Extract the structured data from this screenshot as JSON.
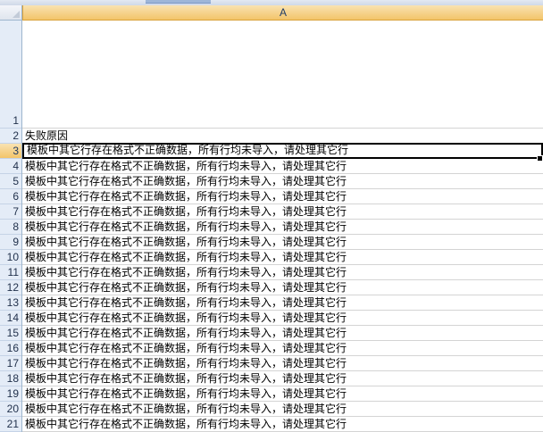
{
  "sheet": {
    "column_header": "A",
    "header_row": {
      "row_number": "2",
      "text": "失败原因"
    },
    "first_row": {
      "row_number": "1",
      "text": ""
    },
    "error_rows": [
      {
        "row_number": "3",
        "text": "模板中其它行存在格式不正确数据，所有行均未导入，请处理其它行"
      },
      {
        "row_number": "4",
        "text": "模板中其它行存在格式不正确数据，所有行均未导入，请处理其它行"
      },
      {
        "row_number": "5",
        "text": "模板中其它行存在格式不正确数据，所有行均未导入，请处理其它行"
      },
      {
        "row_number": "6",
        "text": "模板中其它行存在格式不正确数据，所有行均未导入，请处理其它行"
      },
      {
        "row_number": "7",
        "text": "模板中其它行存在格式不正确数据，所有行均未导入，请处理其它行"
      },
      {
        "row_number": "8",
        "text": "模板中其它行存在格式不正确数据，所有行均未导入，请处理其它行"
      },
      {
        "row_number": "9",
        "text": "模板中其它行存在格式不正确数据，所有行均未导入，请处理其它行"
      },
      {
        "row_number": "10",
        "text": "模板中其它行存在格式不正确数据，所有行均未导入，请处理其它行"
      },
      {
        "row_number": "11",
        "text": "模板中其它行存在格式不正确数据，所有行均未导入，请处理其它行"
      },
      {
        "row_number": "12",
        "text": "模板中其它行存在格式不正确数据，所有行均未导入，请处理其它行"
      },
      {
        "row_number": "13",
        "text": "模板中其它行存在格式不正确数据，所有行均未导入，请处理其它行"
      },
      {
        "row_number": "14",
        "text": "模板中其它行存在格式不正确数据，所有行均未导入，请处理其它行"
      },
      {
        "row_number": "15",
        "text": "模板中其它行存在格式不正确数据，所有行均未导入，请处理其它行"
      },
      {
        "row_number": "16",
        "text": "模板中其它行存在格式不正确数据，所有行均未导入，请处理其它行"
      },
      {
        "row_number": "17",
        "text": "模板中其它行存在格式不正确数据，所有行均未导入，请处理其它行"
      },
      {
        "row_number": "18",
        "text": "模板中其它行存在格式不正确数据，所有行均未导入，请处理其它行"
      },
      {
        "row_number": "19",
        "text": "模板中其它行存在格式不正确数据，所有行均未导入，请处理其它行"
      },
      {
        "row_number": "20",
        "text": "模板中其它行存在格式不正确数据，所有行均未导入，请处理其它行"
      },
      {
        "row_number": "21",
        "text": "模板中其它行存在格式不正确数据，所有行均未导入，请处理其它行"
      }
    ],
    "selected_row_number": "3"
  }
}
